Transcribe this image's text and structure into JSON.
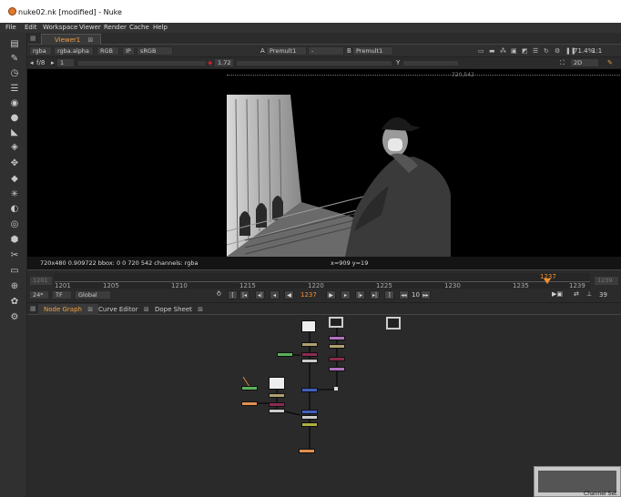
{
  "window": {
    "title": "nuke02.nk [modified] - Nuke"
  },
  "menu": [
    "File",
    "Edit",
    "Workspace",
    "Viewer",
    "Render",
    "Cache",
    "Help"
  ],
  "viewer_tab": {
    "label": "Viewer1",
    "close": "⊠"
  },
  "viewer_controls": {
    "channels": "rgba",
    "alpha": "rgba.alpha",
    "colorspace_mode": "RGB",
    "ip": "IP",
    "lut": "sRGB",
    "input_a_label": "A",
    "input_a_value": "Premult1",
    "compare": "-",
    "input_b_label": "B",
    "input_b_value": "Premult1",
    "zoom_pct": "71.4%",
    "zoom_ratio": "1:1",
    "fstop": "f/8",
    "frame_step": "1",
    "gain_value": "1.72",
    "y_label": "Y",
    "view_mode": "2D"
  },
  "viewer": {
    "format_label": "720,542",
    "status_left": "720x480 0.909722  bbox: 0 0 720 542 channels: rgba",
    "status_coords": "x=909 y=19"
  },
  "timeline": {
    "start": "1201",
    "end": "1239",
    "ticks": [
      "1201",
      "1205",
      "1210",
      "1215",
      "1220",
      "1225",
      "1230",
      "1235",
      "1239"
    ],
    "current_marker": "1237",
    "fps": "24*",
    "tf": "TF",
    "scope": "Global",
    "current_frame": "1237",
    "step": "10",
    "playback_count": "39"
  },
  "panel_tabs": [
    "Node Graph",
    "Curve Editor",
    "Dope Sheet"
  ],
  "minimap_label": "Channel Set"
}
